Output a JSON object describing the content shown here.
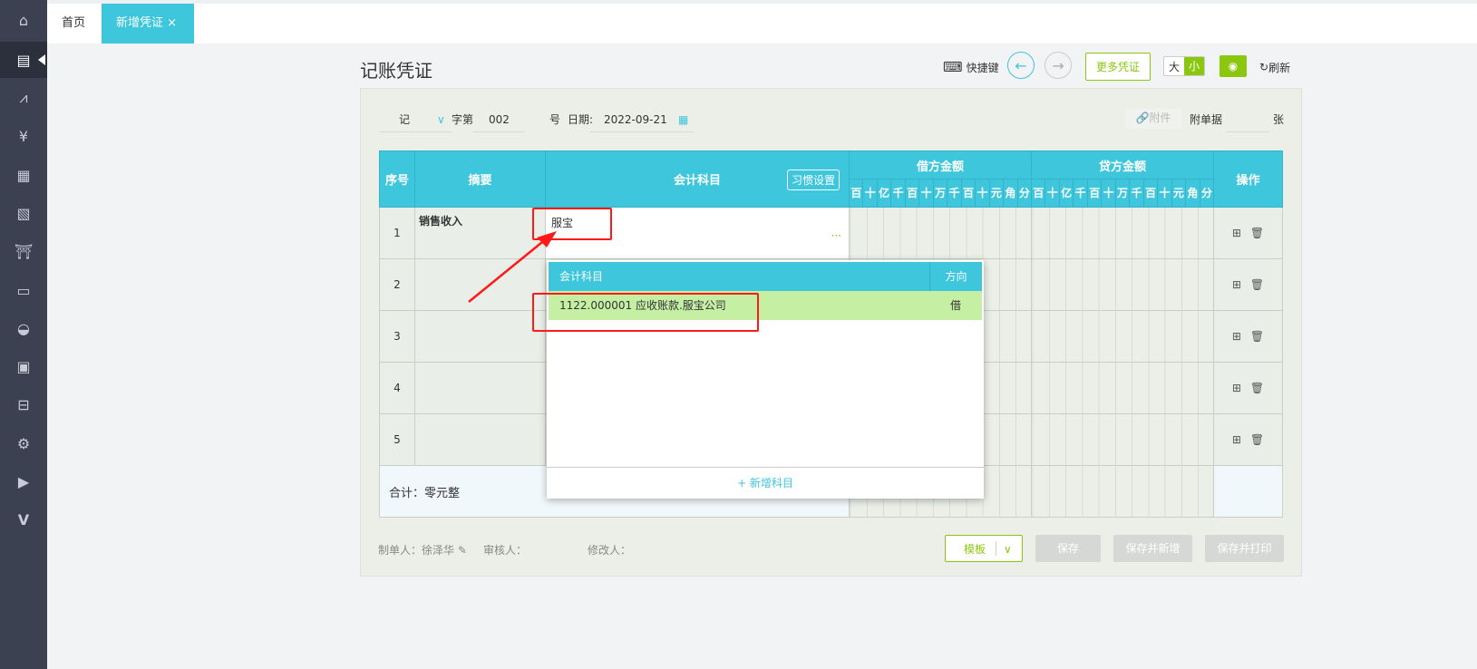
{
  "sidebar": {
    "items": [
      "home-icon",
      "voucher-icon",
      "chart-icon",
      "money-bag-icon",
      "ledger-icon",
      "report-icon",
      "asset-icon",
      "payroll-icon",
      "bowl-icon",
      "invoice-icon",
      "inbox-icon",
      "settings-icon",
      "video-icon",
      "v-logo-icon"
    ],
    "active_index": 1
  },
  "tabs": [
    {
      "label": "首页",
      "active": false
    },
    {
      "label": "新增凭证",
      "active": true,
      "close": "×"
    }
  ],
  "header": {
    "title": "记账凭证",
    "shortcut": "快捷键",
    "more": "更多凭证",
    "size_large": "大",
    "size_small": "小",
    "refresh": "刷新"
  },
  "voucher": {
    "word": "记",
    "word_suffix": "字第",
    "number": "002",
    "number_suffix": "号",
    "date_label": "日期:",
    "date": "2022-09-21",
    "attachment": "附件",
    "attachment_docs": "附单据",
    "attachment_unit": "张"
  },
  "table": {
    "col_no": "序号",
    "col_summary": "摘要",
    "col_account": "会计科目",
    "habit_button": "习惯设置",
    "col_debit": "借方金额",
    "col_credit": "贷方金额",
    "col_ops": "操作",
    "digits": [
      "百",
      "十",
      "亿",
      "千",
      "百",
      "十",
      "万",
      "千",
      "百",
      "十",
      "元",
      "角",
      "分"
    ],
    "rows": [
      {
        "no": "1",
        "summary": "销售收入",
        "account": "服宝"
      },
      {
        "no": "2",
        "summary": "",
        "account": ""
      },
      {
        "no": "3",
        "summary": "",
        "account": ""
      },
      {
        "no": "4",
        "summary": "",
        "account": ""
      },
      {
        "no": "5",
        "summary": "",
        "account": ""
      }
    ],
    "total": "合计：零元整",
    "account_more": "···"
  },
  "dropdown": {
    "col_account": "会计科目",
    "col_direction": "方向",
    "items": [
      {
        "account": "1122.000001 应收账款.服宝公司",
        "direction": "借"
      }
    ],
    "add": "+ 新增科目"
  },
  "footer": {
    "maker_label": "制单人：",
    "maker": "徐泽华",
    "reviewer_label": "审核人：",
    "modifier_label": "修改人：",
    "template": "模板",
    "save": "保存",
    "save_new": "保存并新增",
    "save_print": "保存并打印"
  },
  "colors": {
    "accent": "#3ec6dd",
    "green": "#8cc70f",
    "highlight": "#c5f0a4",
    "annotation": "#ff1a1a"
  }
}
